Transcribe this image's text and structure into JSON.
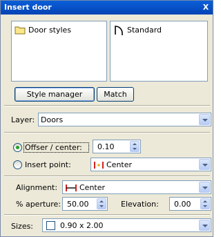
{
  "window": {
    "title": "Insert door",
    "close_label": "X"
  },
  "style_list": {
    "items": [
      {
        "label": "Door styles",
        "icon": "folder-icon"
      }
    ]
  },
  "door_list": {
    "items": [
      {
        "label": "Standard",
        "icon": "door-swing-icon"
      }
    ]
  },
  "buttons": {
    "style_manager": "Style manager",
    "match": "Match"
  },
  "layer": {
    "label": "Layer:",
    "value": "Doors"
  },
  "placement": {
    "offset_center_label": "Offser / center:",
    "offset_value": "0.10",
    "offset_selected": true,
    "insert_point_label": "Insert point:",
    "insert_point_value": "Center",
    "insert_point_icon": "center-marker-icon"
  },
  "alignment": {
    "label": "Alignment:",
    "value": "Center",
    "icon": "center-align-icon"
  },
  "aperture": {
    "label": "% aperture:",
    "value": "50.00"
  },
  "elevation": {
    "label": "Elevation:",
    "value": "0.00"
  },
  "sizes": {
    "label": "Sizes:",
    "value": "0.90 x 2.00",
    "checked": false
  },
  "colors": {
    "title_bar": "#0a5fd8",
    "panel": "#ece9d8",
    "field_border": "#7f9db9",
    "radio_dot": "#21a121",
    "icon_red": "#d62020",
    "icon_amber": "#e8a400"
  }
}
